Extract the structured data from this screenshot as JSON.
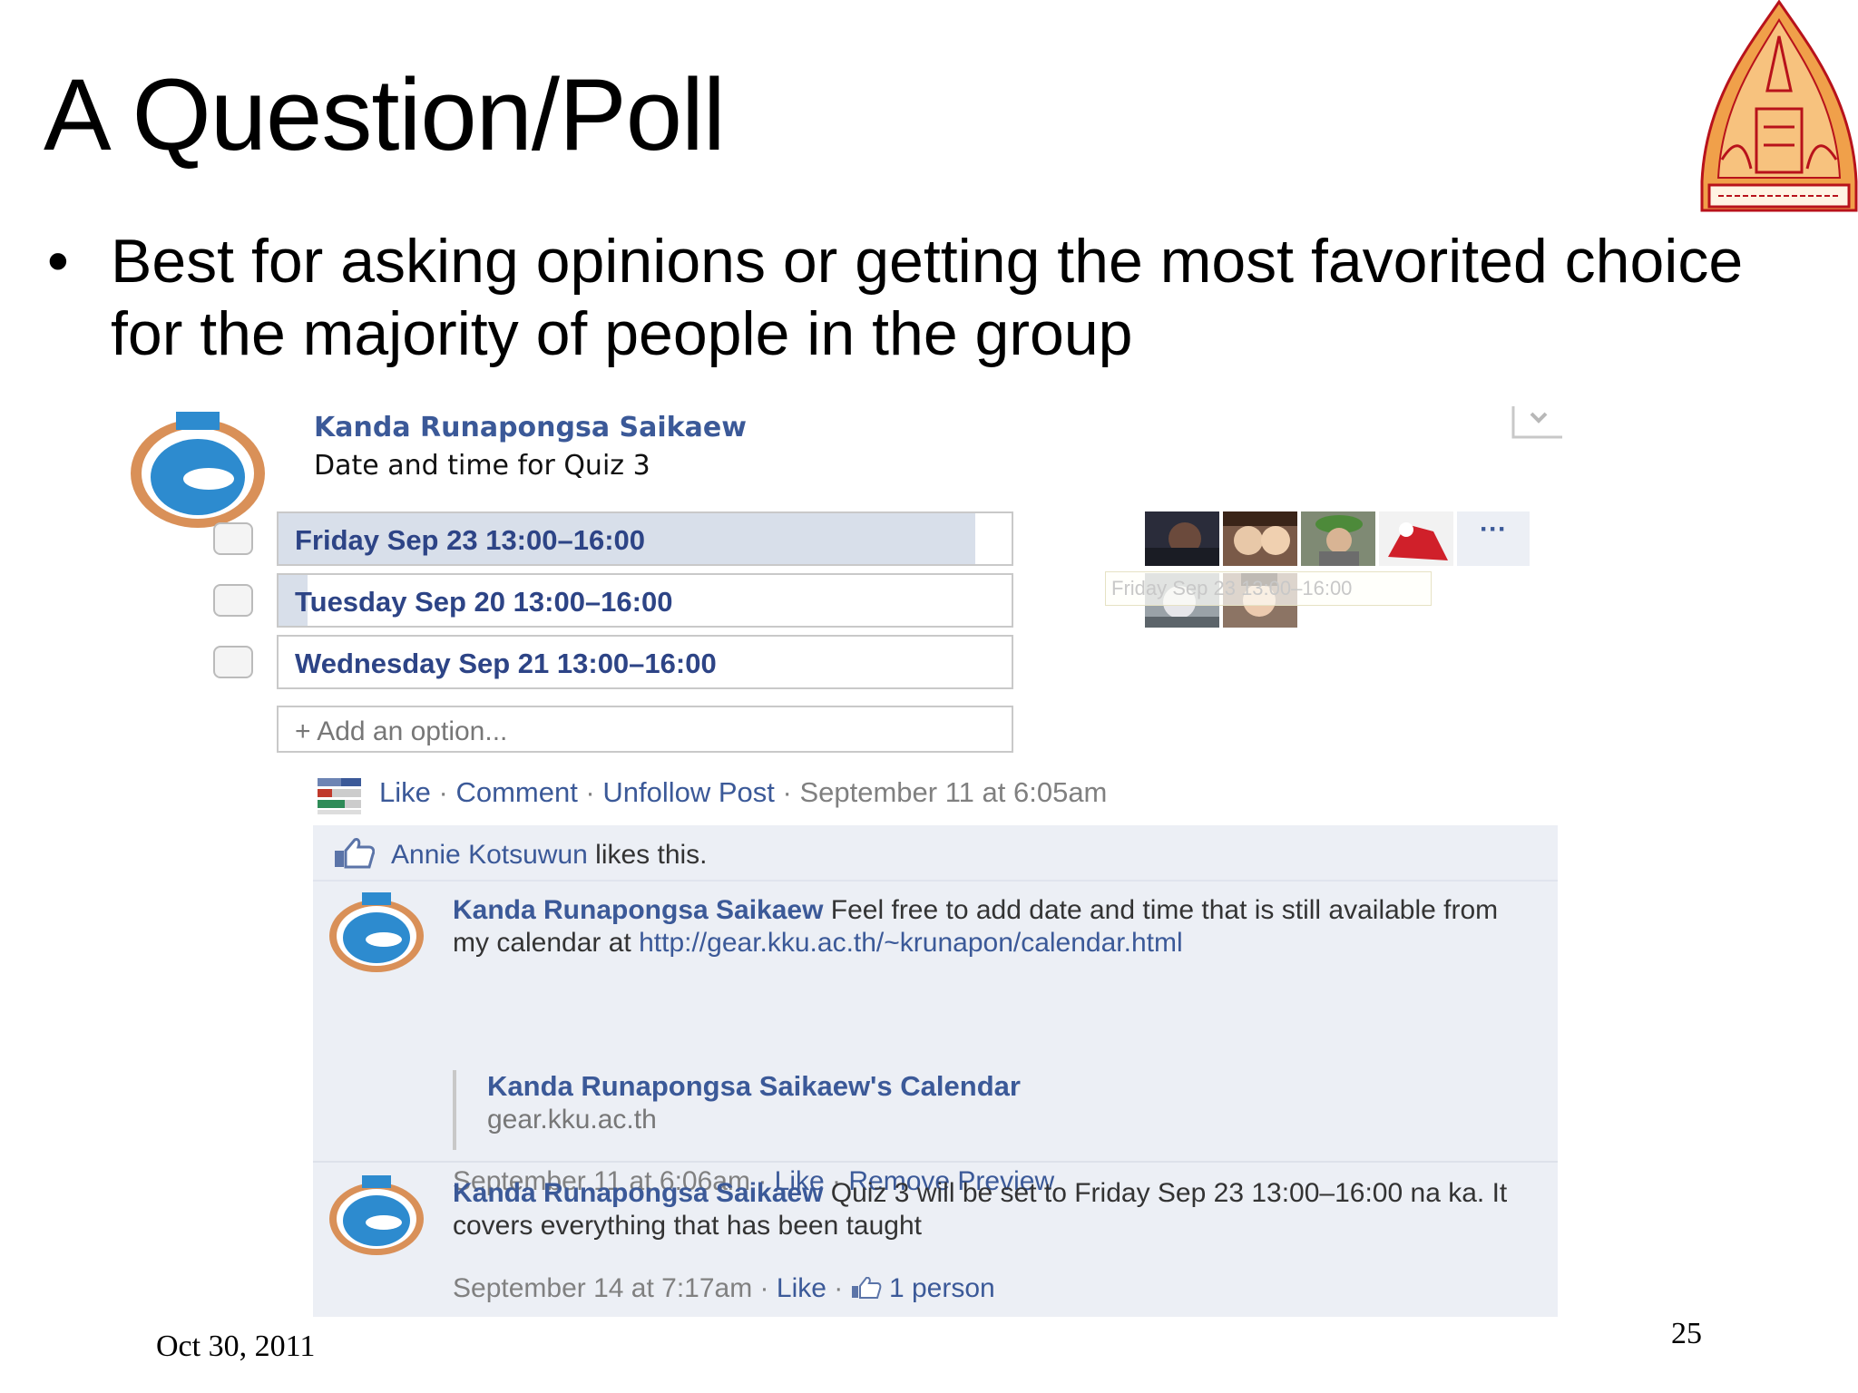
{
  "slide": {
    "title": "A Question/Poll",
    "bullet": "Best for asking opinions or getting the most favorited choice for the majority of people in the group",
    "bullet_glyph": "•",
    "footer_date": "Oct 30, 2011",
    "page_number": "25",
    "logo_icon": "kku-university-seal-icon"
  },
  "post": {
    "author": "Kanda Runapongsa Saikaew",
    "question": "Date and time for Quiz 3",
    "options": [
      {
        "label": "Friday Sep 23 13:00–16:00",
        "vote_share": 0.95
      },
      {
        "label": "Tuesday Sep 20 13:00–16:00",
        "vote_share": 0.04
      },
      {
        "label": "Wednesday Sep 21 13:00–16:00",
        "vote_share": 0
      }
    ],
    "add_option": "+ Add an option...",
    "more_voters": "···",
    "tooltip": "Friday Sep 23 13:00–16:00",
    "actions": {
      "like": "Like",
      "comment": "Comment",
      "unfollow": "Unfollow Post",
      "sep": " · ",
      "timestamp": "September 11 at 6:05am"
    },
    "likes": {
      "name": "Annie Kotsuwun",
      "suffix": " likes this."
    }
  },
  "comments": [
    {
      "author": "Kanda Runapongsa Saikaew",
      "text": " Feel free to add date and time that is still available from my calendar at ",
      "url": "http://gear.kku.ac.th/~krunapon/calendar.html",
      "preview_title": "Kanda Runapongsa Saikaew's Calendar",
      "preview_domain": "gear.kku.ac.th",
      "timestamp": "September 11 at 6:06am",
      "like": "Like",
      "remove_preview": "Remove Preview",
      "sep": " · "
    },
    {
      "author": "Kanda Runapongsa Saikaew",
      "text": " Quiz 3 will be set to Friday Sep 23 13:00–16:00 na ka. It covers everything that has been taught",
      "timestamp": "September 14 at 7:17am",
      "like": "Like",
      "like_count": "1 person",
      "sep": " · "
    }
  ],
  "colors": {
    "fb_link": "#3b5998",
    "poll_fill": "#d8dfea",
    "comment_bg": "#eceff5",
    "logo_orange": "#e8862a",
    "logo_red": "#b8121b"
  }
}
